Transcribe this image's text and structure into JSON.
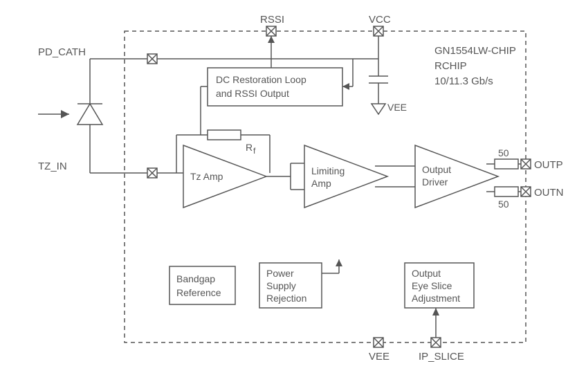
{
  "pins": {
    "pd_cath": "PD_CATH",
    "tz_in": "TZ_IN",
    "rssi": "RSSI",
    "vcc": "VCC",
    "vee_top": "VEE",
    "vee_bottom": "VEE",
    "ip_slice": "IP_SLICE",
    "outp": "OUTP",
    "outn": "OUTN"
  },
  "blocks": {
    "dc_restore_l1": "DC Restoration Loop",
    "dc_restore_l2": "and RSSI Output",
    "tz_amp": "Tz Amp",
    "limiting_l1": "Limiting",
    "limiting_l2": "Amp",
    "driver_l1": "Output",
    "driver_l2": "Driver",
    "bandgap_l1": "Bandgap",
    "bandgap_l2": "Reference",
    "psr_l1": "Power",
    "psr_l2": "Supply",
    "psr_l3": "Rejection",
    "eye_l1": "Output",
    "eye_l2": "Eye Slice",
    "eye_l3": "Adjustment"
  },
  "labels": {
    "rf": "R",
    "rf_sub": "f",
    "r50_a": "50",
    "r50_b": "50"
  },
  "chip": {
    "line1": "GN1554LW-CHIP",
    "line2": "RCHIP",
    "line3": "10/11.3 Gb/s"
  }
}
